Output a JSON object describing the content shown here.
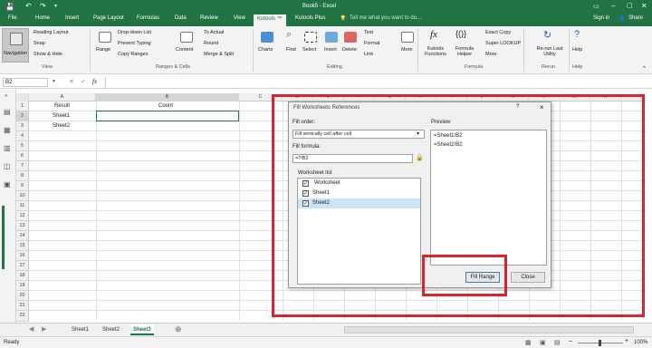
{
  "title_bar": {
    "title": "Book5 - Excel",
    "sign_in": "Sign in",
    "share": "Share"
  },
  "ribbon_tabs": [
    "File",
    "Home",
    "Insert",
    "Page Layout",
    "Formulas",
    "Data",
    "Review",
    "View",
    "Kutools ™",
    "Kutools Plus"
  ],
  "active_tab": "Kutools ™",
  "tell_me": "Tell me what you want to do...",
  "ribbon": {
    "navigation": "Navigation",
    "reading_layout": "Reading Layout",
    "snap": "Snap",
    "show_hide": "Show & Hide",
    "view_group": "View",
    "range": "Range",
    "dropdown_list": "Drop-down List",
    "prevent_typing": "Prevent Typing",
    "copy_ranges": "Copy Ranges",
    "content": "Content",
    "to_actual": "To Actual",
    "round": "Round",
    "merge_split": "Merge & Split",
    "ranges_cells_group": "Ranges & Cells",
    "charts": "Charts",
    "find": "Find",
    "select": "Select",
    "insert": "Insert",
    "delete": "Delete",
    "text": "Text",
    "format": "Format",
    "link": "Link",
    "more": "More",
    "editing_group": "Editing",
    "kutools_functions": "Kutools Functions",
    "formula_helper": "Formula Helper",
    "exact_copy": "Exact Copy",
    "super_lookup": "Super LOOKUP",
    "more2": "More",
    "formula_group": "Formula",
    "rerun": "Re-run Last Utility",
    "rerun_group": "Rerun",
    "help": "Help",
    "help_group": "Help"
  },
  "formula_bar": {
    "name_box": "B2",
    "fx": "fx",
    "value": ""
  },
  "columns": [
    "A",
    "B",
    "C",
    "D",
    "E",
    "F",
    "G",
    "H",
    "I",
    "J",
    "K",
    "L",
    "M",
    "N"
  ],
  "rows": [
    "1",
    "2",
    "3",
    "4",
    "5",
    "6",
    "7",
    "8",
    "9",
    "10",
    "11",
    "12",
    "13",
    "14",
    "15",
    "16",
    "17",
    "18",
    "19",
    "20",
    "21",
    "22"
  ],
  "cells": {
    "A1": "Result",
    "B1": "Count",
    "A2": "Sheet1",
    "A3": "Sheet2"
  },
  "sheet_tabs": [
    "Sheet1",
    "Sheet2",
    "Sheet3"
  ],
  "active_sheet": "Sheet3",
  "status": {
    "ready": "Ready",
    "zoom": "100%"
  },
  "dialog": {
    "title": "Fill Worksheets References",
    "help": "?",
    "close": "×",
    "fill_order_label": "Fill order:",
    "fill_order_value": "Fill vertically cell after cell",
    "fill_formula_label": "Fill formula:",
    "fill_formula_value": "=?!B2",
    "worksheet_list_label": "Worksheet list",
    "worksheets": [
      {
        "name": "Worksheet",
        "checked": true
      },
      {
        "name": "Sheet1",
        "checked": true
      },
      {
        "name": "Sheet2",
        "checked": true
      }
    ],
    "preview_label": "Preview",
    "preview_items": [
      "=Sheet1!B2",
      "=Sheet2!B2"
    ],
    "fill_range_button": "Fill Range",
    "close_button": "Close"
  },
  "colors": {
    "excel_green": "#217346",
    "highlight_red": "#d9232f"
  }
}
